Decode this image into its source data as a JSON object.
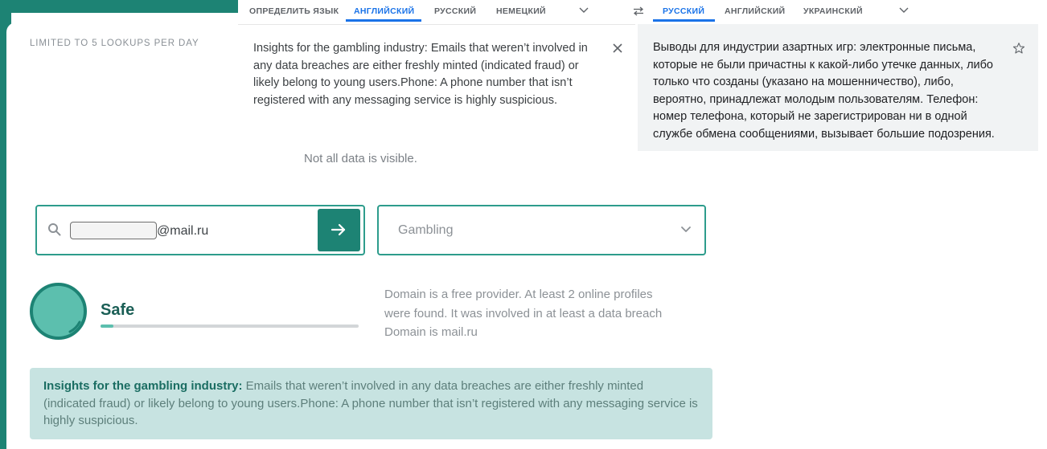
{
  "background_page": {
    "limit_text": "LIMITED TO 5 LOOKUPS PER DAY",
    "not_visible_text": "Not all data is visible.",
    "search": {
      "email_suffix": "@mail.ru"
    },
    "select": {
      "value": "Gambling"
    },
    "score": {
      "label": "Safe",
      "progress_fraction": 0.05
    },
    "description_lines": [
      "Domain is a free provider. At least 2 online profiles",
      "were found. It was involved in at least a data breach",
      "Domain is mail.ru"
    ],
    "insight": {
      "heading": "Insights for the gambling industry:",
      "body": " Emails that weren’t involved in any data breaches are either freshly minted (indicated fraud) or likely belong to young users.Phone: A phone number that isn’t registered with any messaging service is highly suspicious."
    },
    "colors": {
      "teal": "#1d8374",
      "teal_light": "#5cbfae",
      "insight_bg": "#c7e3e1"
    }
  },
  "translator": {
    "source_tabs": [
      "ОПРЕДЕЛИТЬ ЯЗЫК",
      "АНГЛИЙСКИЙ",
      "РУССКИЙ",
      "НЕМЕЦКИЙ"
    ],
    "source_active": "АНГЛИЙСКИЙ",
    "target_tabs": [
      "РУССКИЙ",
      "АНГЛИЙСКИЙ",
      "УКРАИНСКИЙ"
    ],
    "target_active": "РУССКИЙ",
    "source_text": "Insights for the gambling industry: Emails that weren’t involved in any data breaches are either freshly minted (indicated fraud) or likely belong to young users.Phone: A phone number that isn’t registered with any messaging service is highly suspicious.",
    "target_text": "Выводы для индустрии азартных игр: электронные письма, которые не были причастны к какой-либо утечке данных, либо только что созданы (указано на мошенничество), либо, вероятно, принадлежат молодым пользователям. Телефон: номер телефона, который не зарегистрирован ни в одной службе обмена сообщениями, вызывает большие подозрения.",
    "icons": {
      "swap": "swap-languages-icon",
      "close": "close-icon",
      "star": "star-icon"
    },
    "colors": {
      "active_tab": "#1a73e8"
    }
  }
}
